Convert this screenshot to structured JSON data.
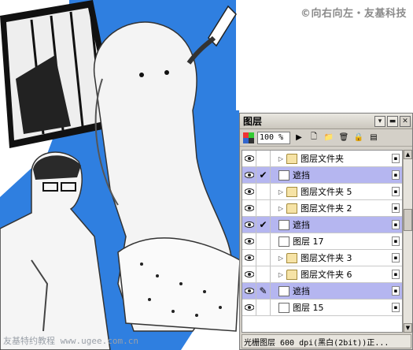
{
  "watermarks": {
    "top": "©向右向左・友基科技",
    "bottom": "友基特约教程 www.ugee.com.cn"
  },
  "artwork": {
    "description_icon": "manga-artwork-image",
    "background_color": "#2f7fe0"
  },
  "layers_panel": {
    "title": "图层",
    "zoom_value": "100 %",
    "status_text": "光栅图层 600 dpi(黑白(2bit))正...",
    "selected_color": "#b5b6f0",
    "layers": [
      {
        "name": "图层文件夹",
        "type": "folder",
        "checked": false,
        "selected": false
      },
      {
        "name": "遮挡",
        "type": "layer",
        "checked": true,
        "selected": true
      },
      {
        "name": "图层文件夹 5",
        "type": "folder",
        "checked": false,
        "selected": false
      },
      {
        "name": "图层文件夹 2",
        "type": "folder",
        "checked": false,
        "selected": false
      },
      {
        "name": "遮挡",
        "type": "layer",
        "checked": true,
        "selected": true
      },
      {
        "name": "图层 17",
        "type": "layer",
        "checked": false,
        "selected": false
      },
      {
        "name": "图层文件夹 3",
        "type": "folder",
        "checked": false,
        "selected": false
      },
      {
        "name": "图层文件夹 6",
        "type": "folder",
        "checked": false,
        "selected": false
      },
      {
        "name": "遮挡",
        "type": "layer",
        "checked": false,
        "selected": true
      },
      {
        "name": "图层 15",
        "type": "layer",
        "checked": false,
        "selected": false
      }
    ]
  }
}
